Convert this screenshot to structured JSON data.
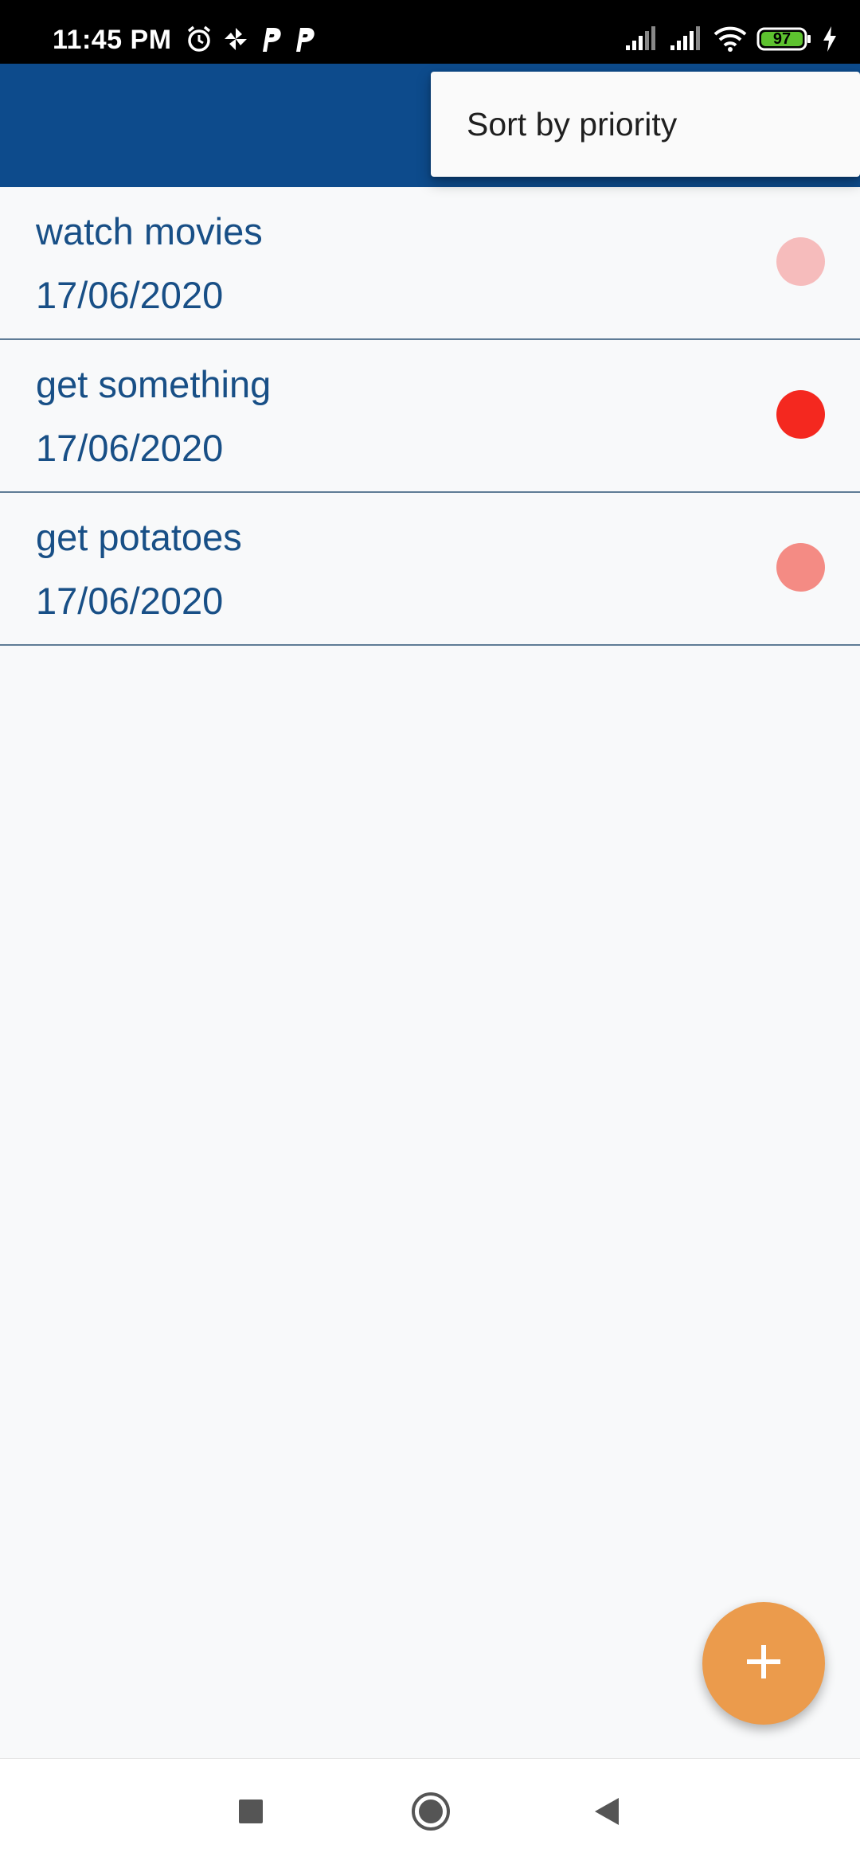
{
  "status_bar": {
    "time": "11:45 PM",
    "battery_level": "97",
    "left_icons": [
      "alarm-icon",
      "pinwheel-icon",
      "p-app-icon",
      "p-app-icon"
    ],
    "right_icons": [
      "signal-icon",
      "signal-icon",
      "wifi-icon",
      "battery-icon",
      "charging-icon"
    ]
  },
  "app_bar": {
    "color": "#0d4b8c"
  },
  "overflow_menu": {
    "items": [
      {
        "label": "Sort by priority"
      }
    ]
  },
  "tasks": [
    {
      "title": "watch movies",
      "date": "17/06/2020",
      "priority_color": "#f6bcbc"
    },
    {
      "title": "get something",
      "date": "17/06/2020",
      "priority_color": "#f4281f"
    },
    {
      "title": "get potatoes",
      "date": "17/06/2020",
      "priority_color": "#f48b84"
    }
  ],
  "fab": {
    "icon": "plus-icon",
    "color": "#eb9b4c"
  },
  "nav_bar": {
    "buttons": [
      "recents-square-icon",
      "home-circle-icon",
      "back-triangle-icon"
    ]
  }
}
